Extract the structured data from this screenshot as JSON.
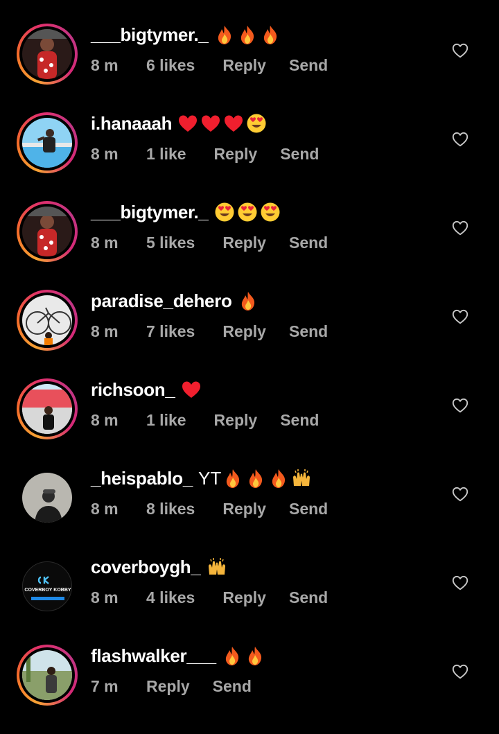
{
  "comments": [
    {
      "username": "___bigtymer._",
      "text": "",
      "emojis": [
        "fire-emoji",
        "fire-emoji",
        "fire-emoji"
      ],
      "time": "8 m",
      "likes": "6 likes",
      "reply": "Reply",
      "send": "Send",
      "story_ring": true,
      "avatar": "red-outfit"
    },
    {
      "username": "i.hanaaah",
      "text": "",
      "emojis": [
        "red-heart-emoji",
        "red-heart-emoji",
        "red-heart-emoji",
        "heart-eyes-emoji"
      ],
      "time": "8 m",
      "likes": "1 like",
      "reply": "Reply",
      "send": "Send",
      "story_ring": true,
      "avatar": "pool"
    },
    {
      "username": "___bigtymer._",
      "text": "",
      "emojis": [
        "heart-eyes-emoji",
        "heart-eyes-emoji",
        "heart-eyes-emoji"
      ],
      "time": "8 m",
      "likes": "5 likes",
      "reply": "Reply",
      "send": "Send",
      "story_ring": true,
      "avatar": "red-outfit"
    },
    {
      "username": "paradise_dehero",
      "text": "",
      "emojis": [
        "fire-emoji"
      ],
      "time": "8 m",
      "likes": "7 likes",
      "reply": "Reply",
      "send": "Send",
      "story_ring": true,
      "avatar": "bicycle"
    },
    {
      "username": "richsoon_",
      "text": "",
      "emojis": [
        "red-heart-emoji"
      ],
      "time": "8 m",
      "likes": "1 like",
      "reply": "Reply",
      "send": "Send",
      "story_ring": true,
      "avatar": "shop"
    },
    {
      "username": "_heispablo_",
      "text": "YT",
      "emojis": [
        "fire-emoji",
        "fire-emoji",
        "fire-emoji",
        "raising-hands-emoji"
      ],
      "time": "8 m",
      "likes": "8 likes",
      "reply": "Reply",
      "send": "Send",
      "story_ring": false,
      "avatar": "grey-person"
    },
    {
      "username": "coverboygh_",
      "text": "",
      "emojis": [
        "raising-hands-emoji"
      ],
      "time": "8 m",
      "likes": "4 likes",
      "reply": "Reply",
      "send": "Send",
      "story_ring": false,
      "avatar": "logo",
      "avatar_logo_text": "COVERBOY KOBBY"
    },
    {
      "username": "flashwalker___",
      "text": "",
      "emojis": [
        "fire-emoji",
        "fire-emoji"
      ],
      "time": "7 m",
      "likes": "",
      "reply": "Reply",
      "send": "Send",
      "story_ring": true,
      "avatar": "outdoor"
    }
  ],
  "icons": {
    "like": "heart-outline-icon"
  },
  "colors": {
    "background": "#000000",
    "meta_text": "#a8a8a8",
    "username": "#ffffff"
  }
}
